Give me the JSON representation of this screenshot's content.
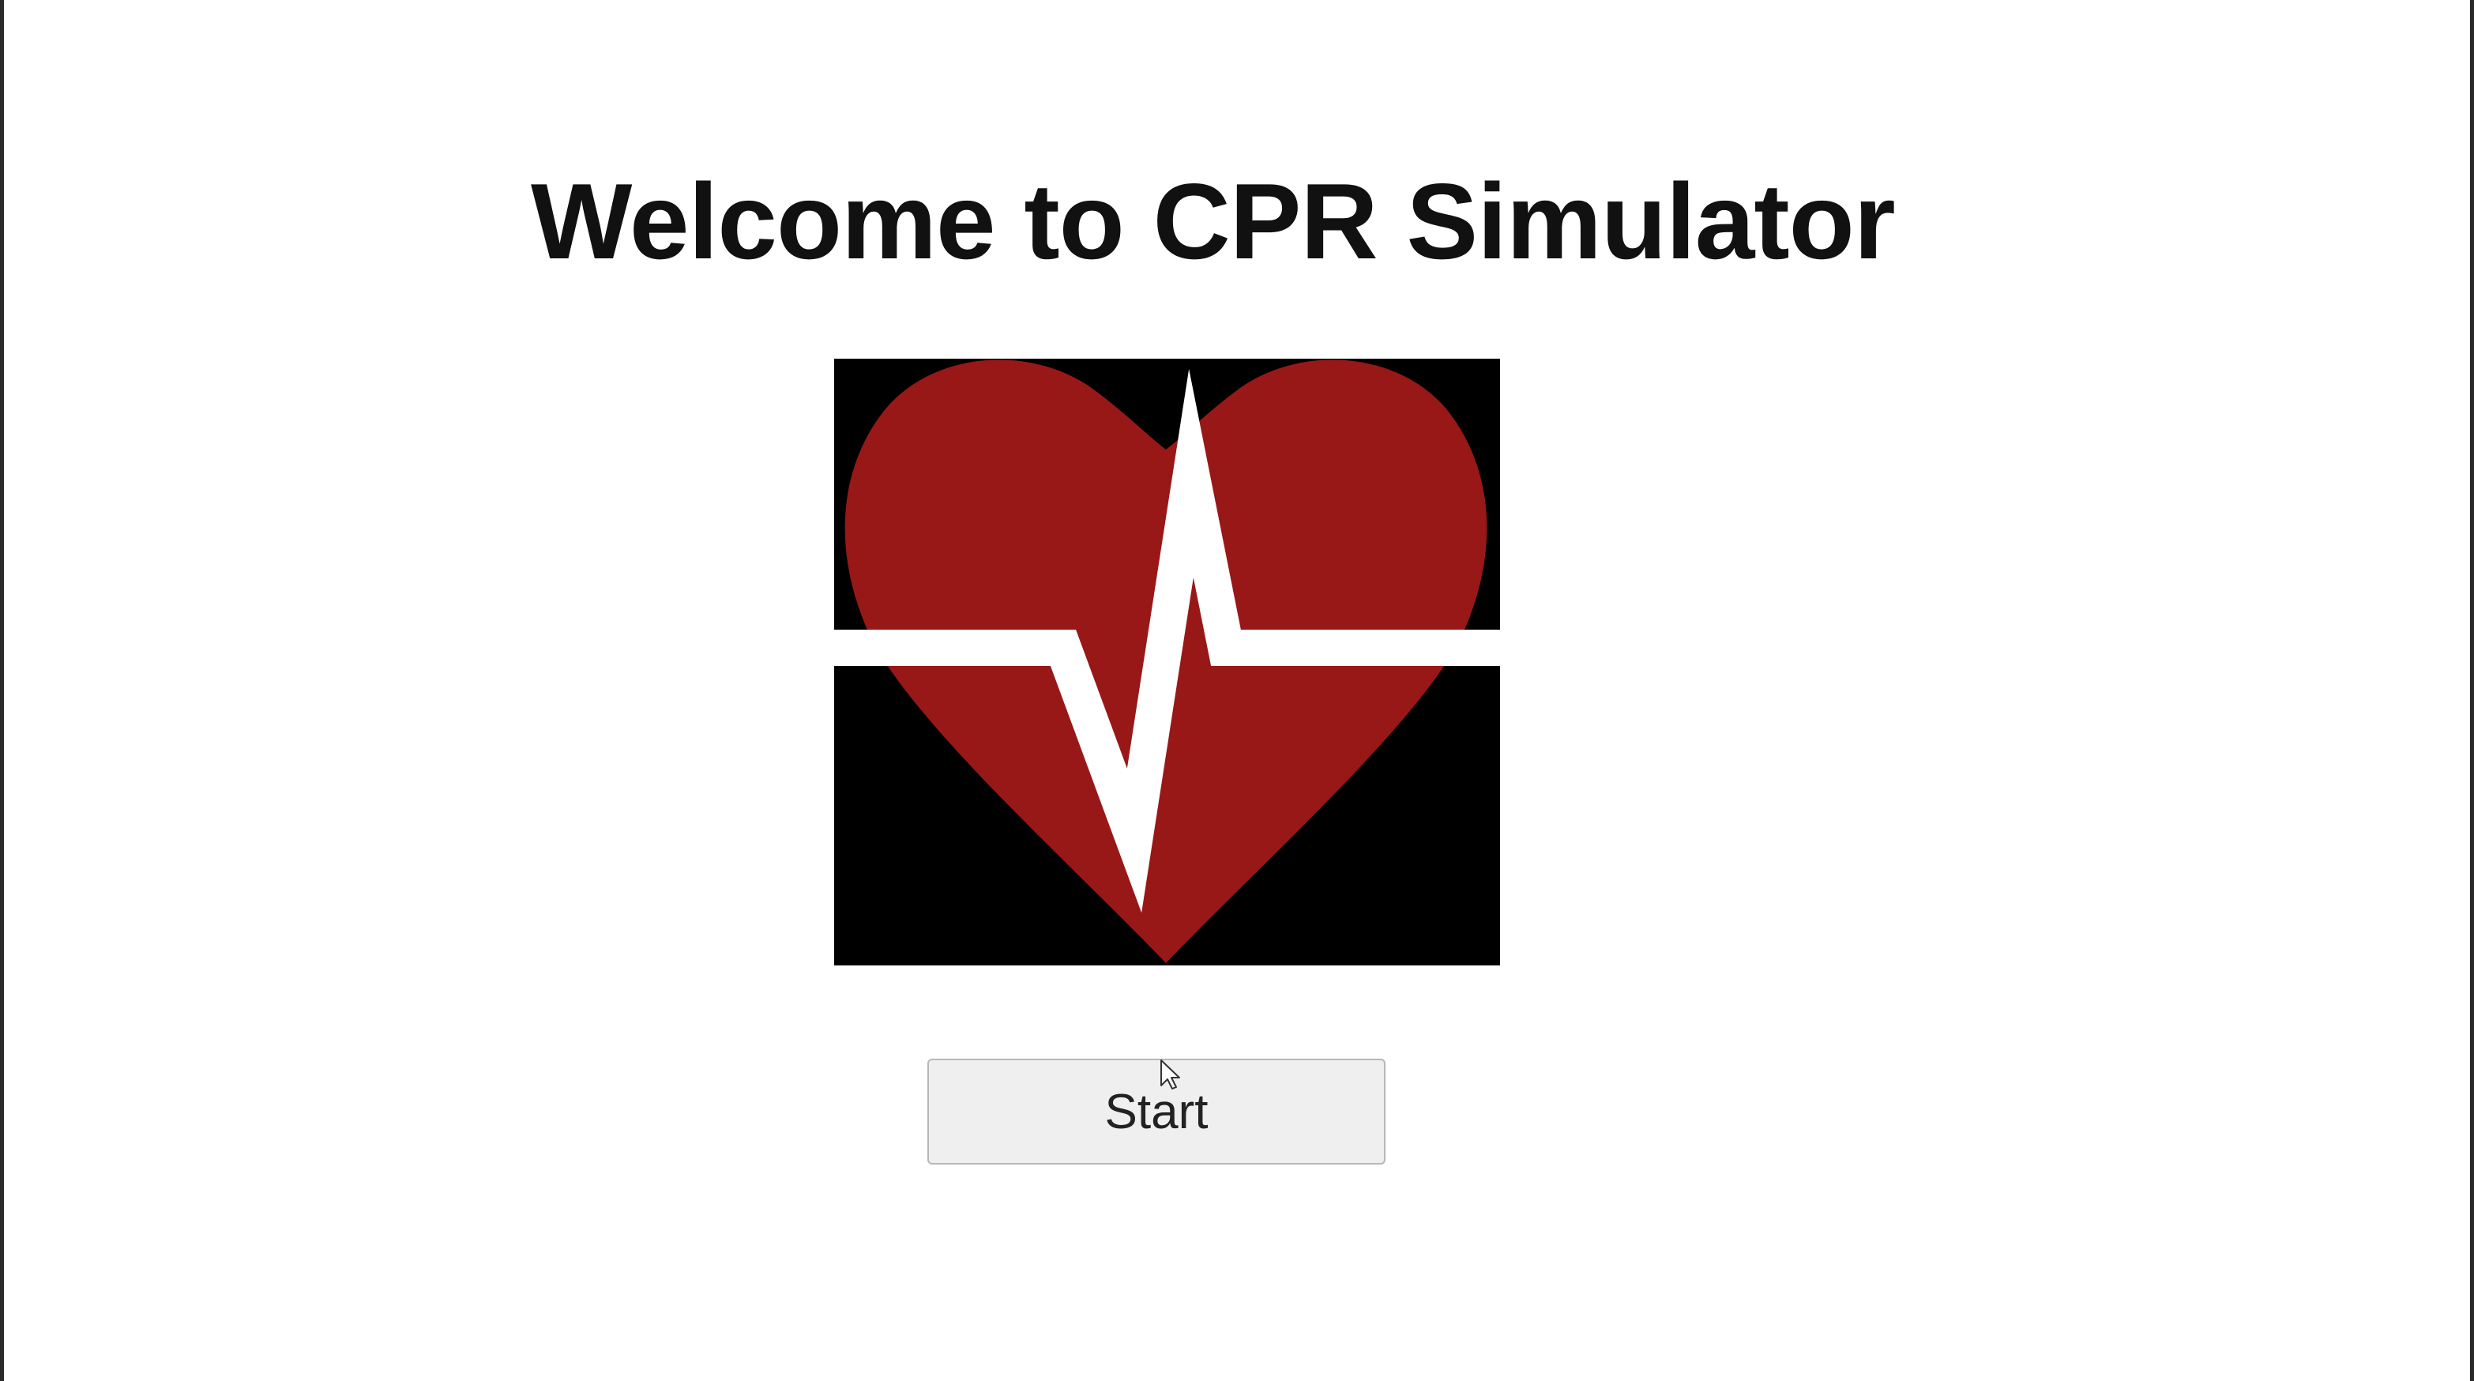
{
  "app": {
    "title": "Welcome to CPR Simulator"
  },
  "logo": {
    "icon": "heart-pulse-icon",
    "colors": {
      "background": "#000000",
      "heart": "#981818",
      "pulse_line": "#ffffff"
    }
  },
  "actions": {
    "start_label": "Start"
  },
  "cursor": {
    "icon": "mouse-pointer-icon"
  }
}
